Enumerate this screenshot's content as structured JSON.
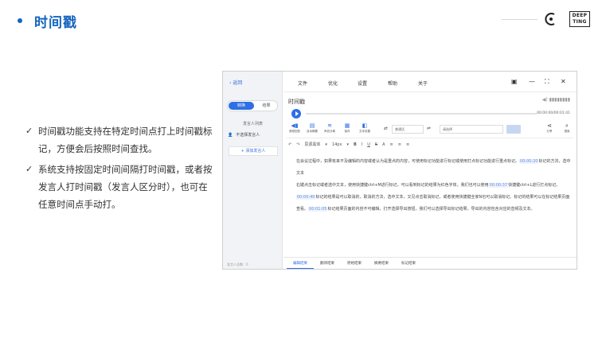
{
  "slide": {
    "title": "时间戳",
    "logo_text": "DEEP TING",
    "bullets": [
      "时间戳功能支持在特定时间点打上时间戳标记，方便会后按照时间查找。",
      "系统支持按固定时间间隔打时间戳，或者按发言人打时间戳（发言人区分时），也可在任意时间点手动打。"
    ],
    "accent_color": "#1565c0"
  },
  "app": {
    "sidebar": {
      "back_label": "返回",
      "toggle_active": "转换",
      "toggle_inactive": "结果",
      "speaker_list_label": "发言人列表",
      "speaker_option": "不选择发言人",
      "add_speaker_label": "添加发言人",
      "footer": "发言人总数：0"
    },
    "menu": [
      "文件",
      "优化",
      "设置",
      "帮助",
      "关于"
    ],
    "window_controls": [
      "▣",
      "—",
      "⛶",
      "✕"
    ],
    "doc_title": "时间戳",
    "playback": {
      "time": "00:00:00/00:01:41"
    },
    "toolbar": {
      "items": [
        {
          "icon": "◀▮",
          "label": "音频回放"
        },
        {
          "icon": "▤",
          "label": "自动摘要"
        },
        {
          "icon": "≋",
          "label": "声纹分离"
        },
        {
          "icon": "▦",
          "label": "保存"
        },
        {
          "icon": "◧",
          "label": "文本设置"
        }
      ],
      "search_placeholder": "普通话",
      "replace_placeholder": "请选择",
      "share_label": "分享",
      "search_label": "搜索"
    },
    "format": {
      "font": "思源黑体",
      "size": "14px",
      "buttons": [
        "B",
        "I",
        "U",
        "S",
        "A",
        "≡",
        "≡",
        "≡"
      ]
    },
    "content": {
      "p1_pre": "在会议过程中，如果有来不及编辑的内容或者认为是重点的内容，可使用标记功能进行标记或使用打点标记功能进行重点标记。",
      "p1_ts": "00:00:20",
      "p1_post": "标记的方法，选中文本",
      "p2_pre": "右键点击标记或者选中文本，使用快捷键ctrl+M进行标记，可以看到标记的结果为红色字体，我们也可以使用",
      "p2_ts": "00:00:37",
      "p2_post": "快捷键ctrl+L进行打点标记。",
      "p3_ts1": "00:00:40",
      "p3_mid": "标记的结果是可以取消的，取消的方法，选中文本，又见点击取消标记，或者使用快捷键全家N也可以取消标记。标记的结果可以在标记结果页面查看。",
      "p3_ts2": "00:01:05",
      "p3_post": "标记结果页面的内容不可编辑，打开选择导出按钮，我们可以选择导出标记结果，导出的内容包含对应的音频及文本。"
    },
    "tabs": [
      "编辑结果",
      "翻译结果",
      "原始结果",
      "摘要结果",
      "标记结果"
    ],
    "active_tab": 0
  }
}
